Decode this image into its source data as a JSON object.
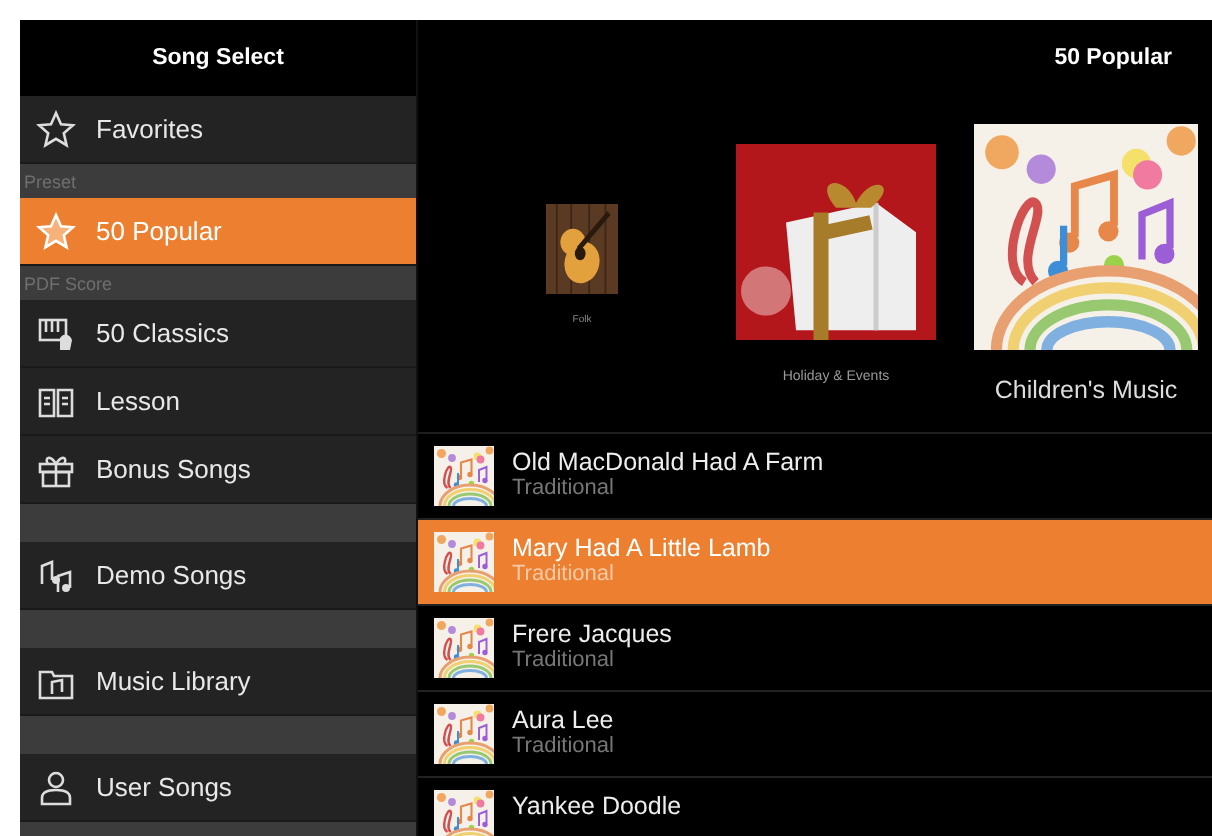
{
  "sidebar": {
    "title": "Song Select",
    "groups": [
      {
        "items": [
          {
            "label": "Favorites",
            "selected": false
          }
        ]
      },
      {
        "heading": "Preset",
        "items": [
          {
            "label": "50 Popular",
            "selected": true
          }
        ]
      },
      {
        "heading": "PDF Score",
        "items": [
          {
            "label": "50 Classics",
            "selected": false
          },
          {
            "label": "Lesson",
            "selected": false
          },
          {
            "label": "Bonus Songs",
            "selected": false
          }
        ]
      },
      {
        "items": [
          {
            "label": "Demo Songs",
            "selected": false
          }
        ]
      },
      {
        "items": [
          {
            "label": "Music Library",
            "selected": false
          }
        ]
      },
      {
        "items": [
          {
            "label": "User Songs",
            "selected": false
          }
        ]
      }
    ]
  },
  "main": {
    "title": "50 Popular",
    "albums": [
      {
        "label": "Folk",
        "selected": false
      },
      {
        "label": "Holiday & Events",
        "selected": false
      },
      {
        "label": "Children's Music",
        "selected": true
      }
    ],
    "songs": [
      {
        "title": "Old MacDonald Had A Farm",
        "artist": "Traditional",
        "selected": false
      },
      {
        "title": "Mary Had A Little Lamb",
        "artist": "Traditional",
        "selected": true
      },
      {
        "title": "Frere Jacques",
        "artist": "Traditional",
        "selected": false
      },
      {
        "title": "Aura Lee",
        "artist": "Traditional",
        "selected": false
      },
      {
        "title": "Yankee Doodle",
        "selected": false
      }
    ]
  }
}
